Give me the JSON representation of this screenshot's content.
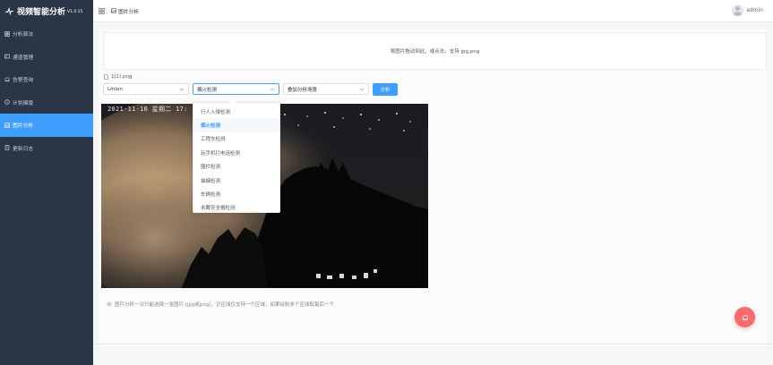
{
  "brand": {
    "title": "视频智能分析",
    "version": "V1.0.15"
  },
  "sidebar": {
    "items": [
      {
        "label": "分析算法",
        "icon": "algorithm-icon",
        "active": false
      },
      {
        "label": "通道管理",
        "icon": "channel-icon",
        "active": false
      },
      {
        "label": "告警查询",
        "icon": "bell-icon",
        "active": false
      },
      {
        "label": "计划模版",
        "icon": "clock-icon",
        "active": false
      },
      {
        "label": "图片分析",
        "icon": "image-icon",
        "active": true
      },
      {
        "label": "更新日志",
        "icon": "document-icon",
        "active": false
      }
    ]
  },
  "header": {
    "breadcrumb": "图片分析",
    "user": "admin"
  },
  "upload": {
    "hint": "将图片拖动到此，或点击，支持 jpg,png"
  },
  "file": {
    "name": "1(1).png"
  },
  "selects": {
    "model": "Lmlon",
    "algorithm": "烟火检测",
    "scene": "叠加分析场景"
  },
  "analyze_button": "分析",
  "photo": {
    "osd_text": "2021-11-16 星期二 17:"
  },
  "dropdown": {
    "options": [
      {
        "label": "行人入侵检测",
        "selected": false
      },
      {
        "label": "烟火检测",
        "selected": true
      },
      {
        "label": "工程车检测",
        "selected": false
      },
      {
        "label": "玩手机打电话检测",
        "selected": false
      },
      {
        "label": "围栏检测",
        "selected": false
      },
      {
        "label": "抽烟检测",
        "selected": false
      },
      {
        "label": "车辆检测",
        "selected": false
      },
      {
        "label": "未戴安全帽检测",
        "selected": false
      }
    ]
  },
  "tip": "图片分析一次只能选择一张图片 (jpg或png)，识区域仅支持一个区域，如果绘制多个区域取最后一个",
  "colors": {
    "sidebar_bg": "#2b3548",
    "accent": "#409eff",
    "fab": "#f56c6c"
  }
}
